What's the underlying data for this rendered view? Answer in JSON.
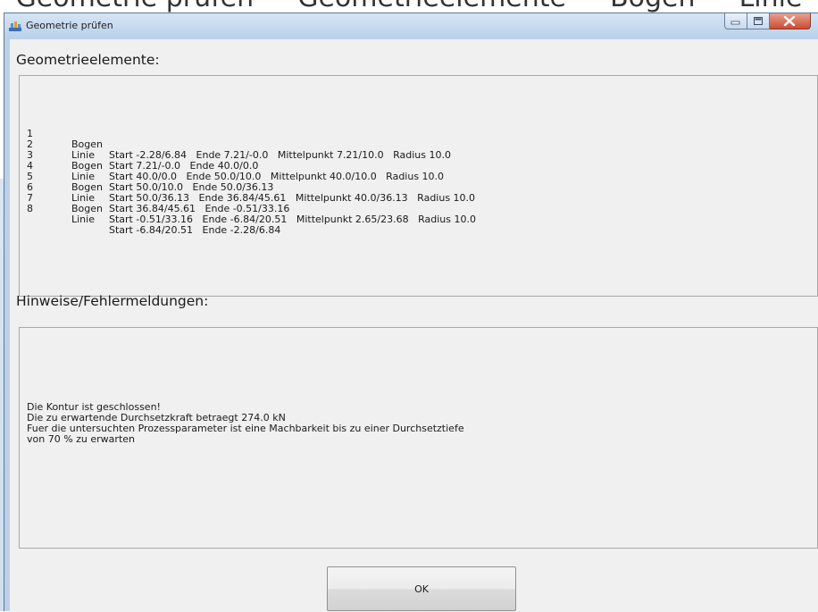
{
  "window": {
    "title": "Geometrie prüfen",
    "caption_buttons": [
      "minimize-icon",
      "maximize-icon",
      "close-icon"
    ]
  },
  "background_text": "Geometrie prüfen — Geometrieelemente — Bogen — Linie",
  "geometry": {
    "heading": "Geometrieelemente:",
    "elements": [
      {
        "num": "1",
        "type": "Bogen",
        "desc": "Start -2.28/6.84   Ende 7.21/-0.0   Mittelpunkt 7.21/10.0   Radius 10.0"
      },
      {
        "num": "2",
        "type": "Linie",
        "desc": "Start 7.21/-0.0   Ende 40.0/0.0"
      },
      {
        "num": "3",
        "type": "Bogen",
        "desc": "Start 40.0/0.0   Ende 50.0/10.0   Mittelpunkt 40.0/10.0   Radius 10.0"
      },
      {
        "num": "4",
        "type": "Linie",
        "desc": "Start 50.0/10.0   Ende 50.0/36.13"
      },
      {
        "num": "5",
        "type": "Bogen",
        "desc": "Start 50.0/36.13   Ende 36.84/45.61   Mittelpunkt 40.0/36.13   Radius 10.0"
      },
      {
        "num": "6",
        "type": "Linie",
        "desc": "Start 36.84/45.61   Ende -0.51/33.16"
      },
      {
        "num": "7",
        "type": "Bogen",
        "desc": "Start -0.51/33.16   Ende -6.84/20.51   Mittelpunkt 2.65/23.68   Radius 10.0"
      },
      {
        "num": "8",
        "type": "Linie",
        "desc": "Start -6.84/20.51   Ende -2.28/6.84"
      }
    ]
  },
  "messages": {
    "heading": "Hinweise/Fehlermeldungen:",
    "lines": [
      "Die Kontur ist geschlossen!",
      "Die zu erwartende Durchsetzkraft betraegt 274.0 kN",
      "Fuer die untersuchten Prozessparameter ist eine Machbarkeit bis zu einer Durchsetztiefe",
      "von 70 % zu erwarten"
    ]
  },
  "ok_button": {
    "label": "OK"
  }
}
